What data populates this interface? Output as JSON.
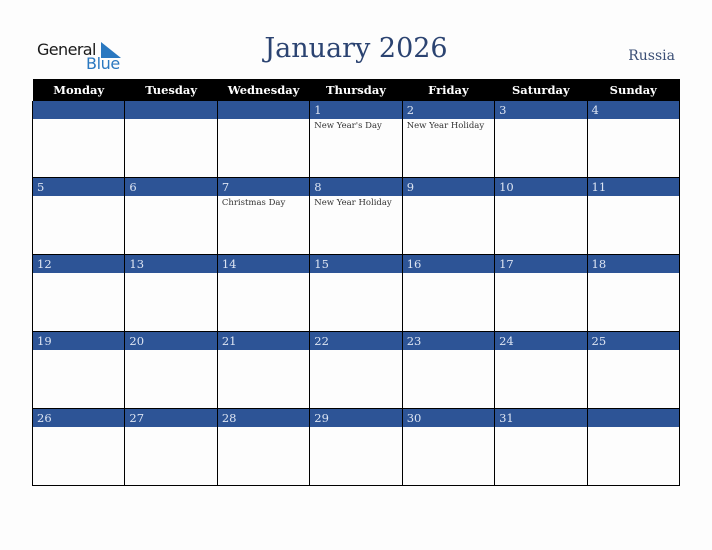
{
  "logo": {
    "word1": "General",
    "word2": "Blue",
    "mark_color": "#2a78c0"
  },
  "header": {
    "title": "January 2026",
    "country": "Russia"
  },
  "colors": {
    "title": "#2b4371",
    "header_bg": "#000000",
    "daynum_bg": "#2d5496"
  },
  "weekdays": [
    "Monday",
    "Tuesday",
    "Wednesday",
    "Thursday",
    "Friday",
    "Saturday",
    "Sunday"
  ],
  "weeks": [
    [
      {
        "day": "",
        "holiday": ""
      },
      {
        "day": "",
        "holiday": ""
      },
      {
        "day": "",
        "holiday": ""
      },
      {
        "day": "1",
        "holiday": "New Year's Day"
      },
      {
        "day": "2",
        "holiday": "New Year Holiday"
      },
      {
        "day": "3",
        "holiday": ""
      },
      {
        "day": "4",
        "holiday": ""
      }
    ],
    [
      {
        "day": "5",
        "holiday": ""
      },
      {
        "day": "6",
        "holiday": ""
      },
      {
        "day": "7",
        "holiday": "Christmas Day"
      },
      {
        "day": "8",
        "holiday": "New Year Holiday"
      },
      {
        "day": "9",
        "holiday": ""
      },
      {
        "day": "10",
        "holiday": ""
      },
      {
        "day": "11",
        "holiday": ""
      }
    ],
    [
      {
        "day": "12",
        "holiday": ""
      },
      {
        "day": "13",
        "holiday": ""
      },
      {
        "day": "14",
        "holiday": ""
      },
      {
        "day": "15",
        "holiday": ""
      },
      {
        "day": "16",
        "holiday": ""
      },
      {
        "day": "17",
        "holiday": ""
      },
      {
        "day": "18",
        "holiday": ""
      }
    ],
    [
      {
        "day": "19",
        "holiday": ""
      },
      {
        "day": "20",
        "holiday": ""
      },
      {
        "day": "21",
        "holiday": ""
      },
      {
        "day": "22",
        "holiday": ""
      },
      {
        "day": "23",
        "holiday": ""
      },
      {
        "day": "24",
        "holiday": ""
      },
      {
        "day": "25",
        "holiday": ""
      }
    ],
    [
      {
        "day": "26",
        "holiday": ""
      },
      {
        "day": "27",
        "holiday": ""
      },
      {
        "day": "28",
        "holiday": ""
      },
      {
        "day": "29",
        "holiday": ""
      },
      {
        "day": "30",
        "holiday": ""
      },
      {
        "day": "31",
        "holiday": ""
      },
      {
        "day": "",
        "holiday": ""
      }
    ]
  ]
}
